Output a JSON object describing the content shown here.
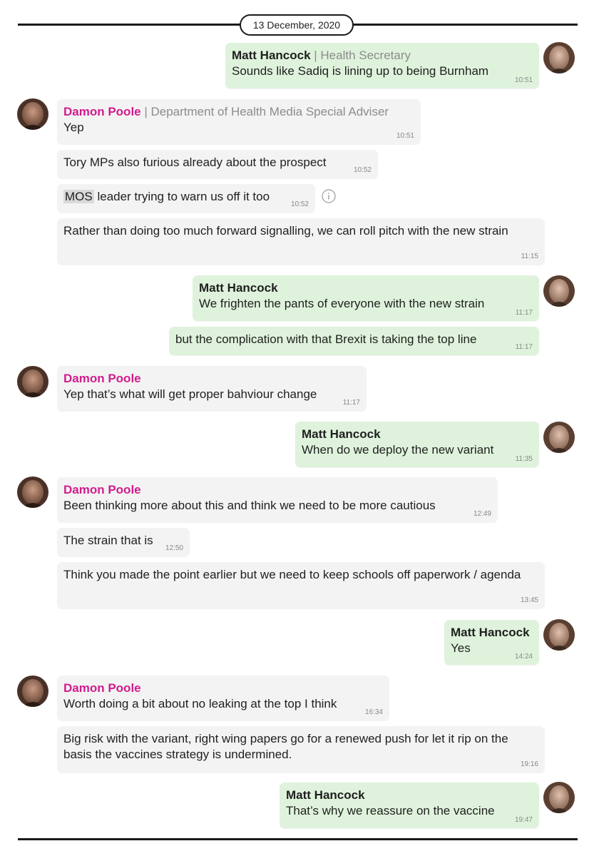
{
  "date": "13 December, 2020",
  "icons": {
    "avatar_left": "person-avatar-icon",
    "avatar_right": "person-avatar-icon",
    "info": "info-icon"
  },
  "colors": {
    "incoming_bubble": "#f3f3f3",
    "outgoing_bubble": "#dff3dc",
    "damon_name": "#d11c8e"
  },
  "senders": {
    "matt": "Matt Hancock",
    "matt_role": "| Health Secretary",
    "damon": "Damon Poole",
    "damon_role": "| Department of Health Media Special Adviser"
  },
  "messages": [
    {
      "text": "Sounds like Sadiq is lining up to being Burnham",
      "time": "10:51"
    },
    {
      "text": "Yep",
      "time": "10:51"
    },
    {
      "text": "Tory MPs also furious already about the prospect",
      "time": "10:52"
    },
    {
      "highlight": "MOS",
      "text": " leader trying to warn us off it too",
      "time": "10:52"
    },
    {
      "text": "Rather than doing too much forward signalling, we can roll pitch with the new strain",
      "time": "11:15"
    },
    {
      "text": "We frighten the pants of everyone with the new strain",
      "time": "11:17"
    },
    {
      "text": "but the complication with that Brexit is taking the top line",
      "time": "11:17"
    },
    {
      "text": "Yep that’s what will get proper bahviour change",
      "time": "11:17"
    },
    {
      "text": "When do we deploy the new variant",
      "time": "11:35"
    },
    {
      "text": "Been thinking more about this and think we need to be more cautious",
      "time": "12:49"
    },
    {
      "text": "The strain that is",
      "time": "12:50"
    },
    {
      "text": "Think you made the point earlier but we need to keep schools off paperwork / agenda",
      "time": "13:45"
    },
    {
      "text": "Yes",
      "time": "14:24"
    },
    {
      "text": "Worth doing a bit about no leaking at the top I think",
      "time": "16:34"
    },
    {
      "text": "Big risk with the variant, right wing papers go for a renewed push for let it rip on the basis the vaccines strategy is undermined.",
      "time": "19:16"
    },
    {
      "text": "That’s why we reassure on the vaccine",
      "time": "19:47"
    }
  ]
}
